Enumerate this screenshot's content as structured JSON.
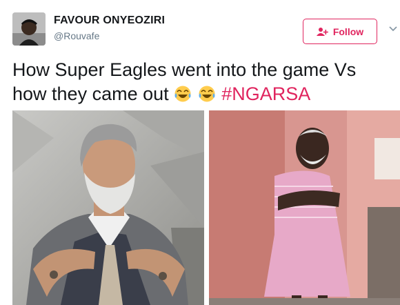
{
  "user": {
    "name": "FAVOUR ONYEOZIRI",
    "handle": "@Rouvafe",
    "avatar_icon": "user-avatar"
  },
  "follow": {
    "label": "Follow",
    "icon": "add-user-icon"
  },
  "menu": {
    "icon": "chevron-down-icon"
  },
  "tweet": {
    "text_part1": "How Super Eagles went into the game Vs how they came out",
    "emojis": [
      "face-with-tears-of-joy",
      "face-with-tears-of-joy"
    ],
    "hashtag": "#NGARSA"
  },
  "colors": {
    "accent": "#e0245e",
    "text": "#14171a",
    "secondary": "#657786"
  }
}
